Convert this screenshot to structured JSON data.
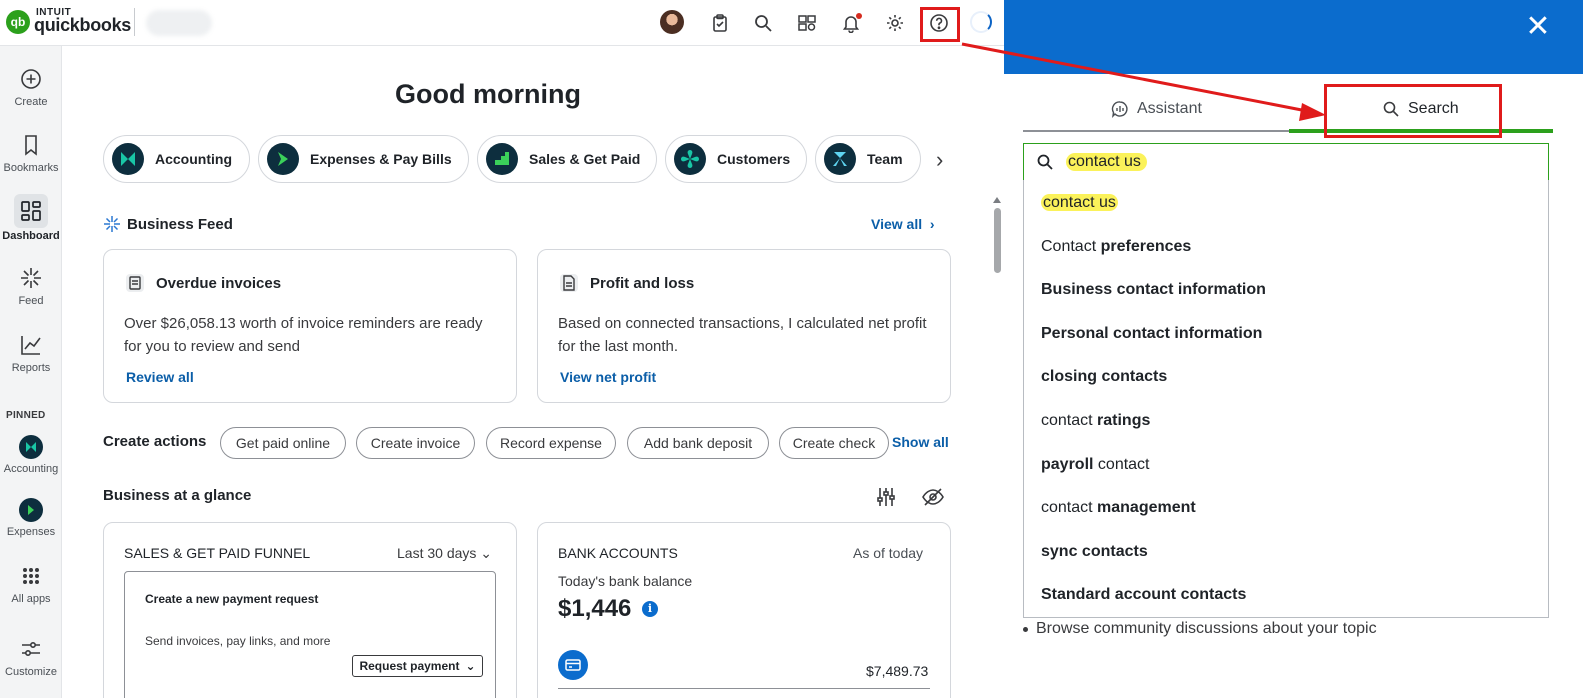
{
  "brand": {
    "intuit": "INTUIT",
    "name": "quickbooks",
    "mark": "qb"
  },
  "topbar": {
    "icons": [
      "avatar",
      "clipboard-icon",
      "search-icon",
      "apps-icon",
      "bell-icon",
      "gear-icon",
      "help-icon",
      "loading-icon"
    ]
  },
  "sidebar": {
    "items": [
      {
        "label": "Create",
        "icon": "plus-circle-icon"
      },
      {
        "label": "Bookmarks",
        "icon": "bookmark-icon"
      },
      {
        "label": "Dashboard",
        "icon": "dashboard-icon"
      },
      {
        "label": "Feed",
        "icon": "feed-icon"
      },
      {
        "label": "Reports",
        "icon": "reports-icon"
      }
    ],
    "pinned_label": "PINNED",
    "pinned": [
      {
        "label": "Accounting",
        "icon": "accounting-icon"
      },
      {
        "label": "Expenses",
        "icon": "expenses-icon"
      }
    ],
    "bottom": [
      {
        "label": "All apps",
        "icon": "grid-icon"
      },
      {
        "label": "Customize",
        "icon": "sliders-icon"
      }
    ]
  },
  "main": {
    "greeting": "Good morning",
    "categories": [
      "Accounting",
      "Expenses & Pay Bills",
      "Sales & Get Paid",
      "Customers",
      "Team"
    ],
    "feed": {
      "title": "Business Feed",
      "view_all": "View all",
      "cards": [
        {
          "title": "Overdue invoices",
          "body": "Over $26,058.13 worth of invoice reminders are ready for you to review and send",
          "link": "Review all"
        },
        {
          "title": "Profit and loss",
          "body": "Based on connected transactions, I calculated net profit for the last month.",
          "link": "View net profit"
        }
      ]
    },
    "create_actions": {
      "label": "Create actions",
      "buttons": [
        "Get paid online",
        "Create invoice",
        "Record expense",
        "Add bank deposit",
        "Create check"
      ],
      "show_all": "Show all"
    },
    "glance": {
      "title": "Business at a glance",
      "sales_card": {
        "title": "SALES & GET PAID FUNNEL",
        "range": "Last 30 days",
        "inner_title": "Create a new payment request",
        "inner_body": "Send invoices, pay links, and more",
        "button": "Request payment"
      },
      "bank_card": {
        "title": "BANK ACCOUNTS",
        "as_of": "As of today",
        "balance_label": "Today's bank balance",
        "balance": "$1,446",
        "account_amount": "$7,489.73"
      }
    }
  },
  "panel": {
    "tabs": {
      "assistant": "Assistant",
      "search": "Search"
    },
    "search_value": "contact us",
    "suggestions": [
      {
        "normal": "contact us",
        "bold": ""
      },
      {
        "normal": "Contact ",
        "bold": "preferences"
      },
      {
        "normal": "",
        "bold": "Business contact information"
      },
      {
        "normal": "",
        "bold": "Personal contact information"
      },
      {
        "normal": "",
        "bold": "closing contacts"
      },
      {
        "normal": "contact ",
        "bold": "ratings"
      },
      {
        "bold_first": "payroll",
        "normal_after": " contact"
      },
      {
        "normal": "contact ",
        "bold": "management"
      },
      {
        "normal": "",
        "bold": "sync contacts"
      },
      {
        "normal": "",
        "bold": "Standard account contacts"
      }
    ],
    "bullet": "Browse community discussions about your topic"
  },
  "colors": {
    "brand_green": "#2ca01c",
    "link_blue": "#0b5ea8",
    "panel_blue": "#0b6ccd",
    "annotation_red": "#e01b1b",
    "highlight_yellow": "#fbf25a"
  }
}
